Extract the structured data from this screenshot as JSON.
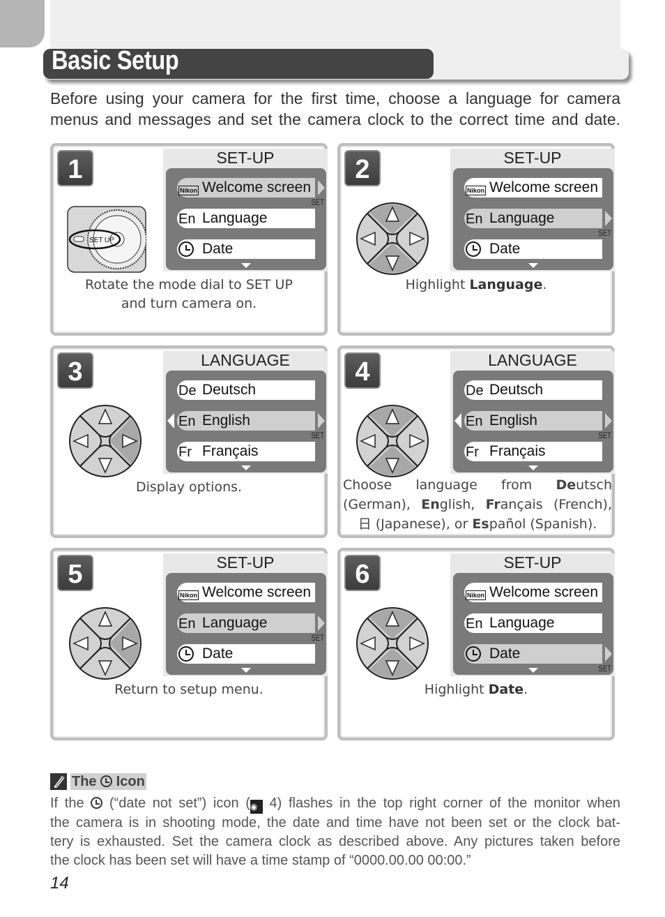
{
  "page": {
    "title": "Basic Setup",
    "intro_lines": [
      "Before using your camera for the first time, choose a language for camera",
      "menus and messages and set the camera clock to the correct time and date."
    ],
    "page_number": "14"
  },
  "menu_common": {
    "set_label": "SET",
    "nikon_label": "Nikon",
    "setup_title": "SET-UP",
    "language_title": "LANGUAGE"
  },
  "steps": [
    {
      "number": "1",
      "screen_title": "SET-UP",
      "items": [
        {
          "icon": "nikon",
          "prefix": "",
          "label": "Welcome screen",
          "highlighted": true
        },
        {
          "icon": "text",
          "prefix": "En",
          "label": "Language",
          "highlighted": false
        },
        {
          "icon": "clock",
          "prefix": "",
          "label": "Date",
          "highlighted": false
        }
      ],
      "caption_lines": [
        "Rotate the mode dial to SET UP",
        "and turn camera on."
      ],
      "dial_label": "SET UP"
    },
    {
      "number": "2",
      "screen_title": "SET-UP",
      "items": [
        {
          "icon": "nikon",
          "prefix": "",
          "label": "Welcome screen",
          "highlighted": false
        },
        {
          "icon": "text",
          "prefix": "En",
          "label": "Language",
          "highlighted": true
        },
        {
          "icon": "clock",
          "prefix": "",
          "label": "Date",
          "highlighted": false
        }
      ],
      "caption_plain": "Highlight ",
      "caption_bold": "Language",
      "caption_end": ".",
      "dpad_pressed": [
        "up",
        "down"
      ]
    },
    {
      "number": "3",
      "screen_title": "LANGUAGE",
      "items": [
        {
          "icon": "text",
          "prefix": "De",
          "label": "Deutsch",
          "highlighted": false
        },
        {
          "icon": "text",
          "prefix": "En",
          "label": "English",
          "highlighted": true
        },
        {
          "icon": "text",
          "prefix": "Fr",
          "label": "Français",
          "highlighted": false
        }
      ],
      "caption": "Display options.",
      "dpad_pressed": [
        "right"
      ]
    },
    {
      "number": "4",
      "screen_title": "LANGUAGE",
      "items": [
        {
          "icon": "text",
          "prefix": "De",
          "label": "Deutsch",
          "highlighted": false
        },
        {
          "icon": "text",
          "prefix": "En",
          "label": "English",
          "highlighted": true
        },
        {
          "icon": "text",
          "prefix": "Fr",
          "label": "Français",
          "highlighted": false
        }
      ],
      "caption": {
        "line1": [
          "Choose",
          "language",
          "from",
          "De",
          "utsch"
        ],
        "line2_parts": [
          "(German), ",
          "En",
          "glish, ",
          "Fr",
          "ançais (French),"
        ],
        "line3_parts": [
          "日",
          " (Japanese), or ",
          "Es",
          "pañol (Spanish)."
        ]
      },
      "dpad_pressed": [
        "up",
        "down"
      ]
    },
    {
      "number": "5",
      "screen_title": "SET-UP",
      "items": [
        {
          "icon": "nikon",
          "prefix": "",
          "label": "Welcome screen",
          "highlighted": false
        },
        {
          "icon": "text",
          "prefix": "En",
          "label": "Language",
          "highlighted": true
        },
        {
          "icon": "clock",
          "prefix": "",
          "label": "Date",
          "highlighted": false
        }
      ],
      "caption": "Return to setup menu.",
      "dpad_pressed": [
        "right"
      ]
    },
    {
      "number": "6",
      "screen_title": "SET-UP",
      "items": [
        {
          "icon": "nikon",
          "prefix": "",
          "label": "Welcome screen",
          "highlighted": false
        },
        {
          "icon": "text",
          "prefix": "En",
          "label": "Language",
          "highlighted": false
        },
        {
          "icon": "clock",
          "prefix": "",
          "label": "Date",
          "highlighted": true
        }
      ],
      "caption_plain": "Highlight ",
      "caption_bold": "Date",
      "caption_end": ".",
      "dpad_pressed": [
        "up",
        "down"
      ]
    }
  ],
  "note": {
    "title_before": "The ",
    "title_after": " Icon",
    "lines": [
      [
        "If the ",
        " (“date not set”) icon (",
        " 4) flashes in the top right corner of the monitor when"
      ],
      "the camera is in shooting mode, the date and time have not been set or the clock bat-",
      "tery is exhausted.  Set the camera clock as described above.  Any pictures taken before",
      "the clock has been set will have a time stamp of  “0000.00.00 00:00.”"
    ]
  }
}
